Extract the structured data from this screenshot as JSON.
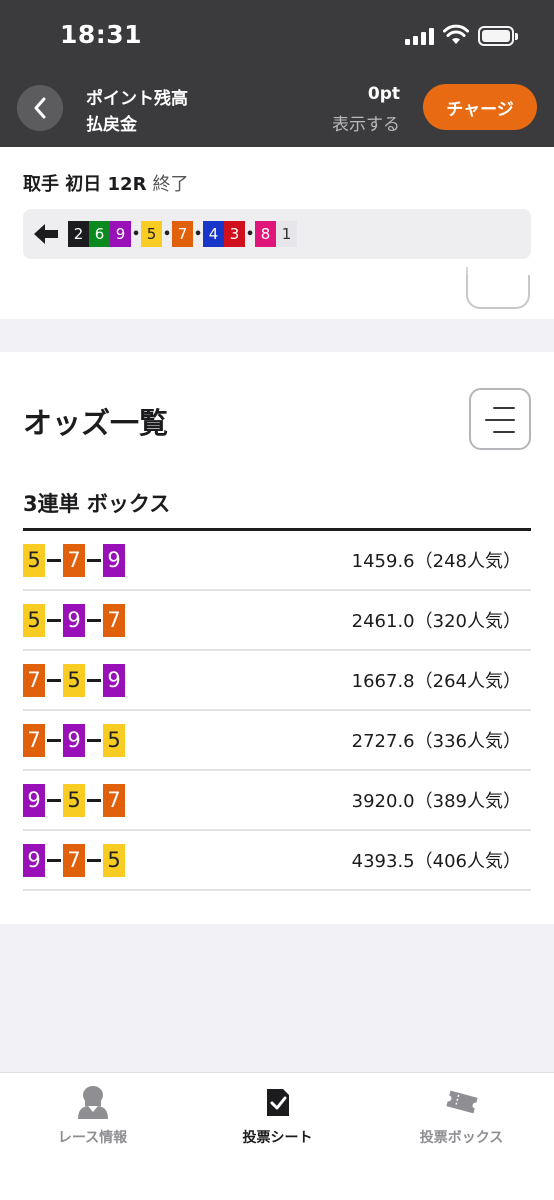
{
  "status_bar": {
    "time": "18:31"
  },
  "header": {
    "point_label": "ポイント残高",
    "payout_label": "払戻金",
    "point_value": "0pt",
    "show_label": "表示する",
    "charge_label": "チャージ"
  },
  "race": {
    "title": "取手 初日 12R",
    "status": "終了",
    "order": [
      {
        "n": "2",
        "sep": ""
      },
      {
        "n": "6",
        "sep": ""
      },
      {
        "n": "9",
        "sep": "•"
      },
      {
        "n": "5",
        "sep": "•"
      },
      {
        "n": "7",
        "sep": "•"
      },
      {
        "n": "4",
        "sep": ""
      },
      {
        "n": "3",
        "sep": "•"
      },
      {
        "n": "8",
        "sep": ""
      },
      {
        "n": "1",
        "sep": ""
      }
    ]
  },
  "odds": {
    "title": "オッズ一覧",
    "subtitle": "3連単 ボックス",
    "rows": [
      {
        "combo": [
          "5",
          "7",
          "9"
        ],
        "text": "1459.6（248人気）"
      },
      {
        "combo": [
          "5",
          "9",
          "7"
        ],
        "text": "2461.0（320人気）"
      },
      {
        "combo": [
          "7",
          "5",
          "9"
        ],
        "text": "1667.8（264人気）"
      },
      {
        "combo": [
          "7",
          "9",
          "5"
        ],
        "text": "2727.6（336人気）"
      },
      {
        "combo": [
          "9",
          "5",
          "7"
        ],
        "text": "3920.0（389人気）"
      },
      {
        "combo": [
          "9",
          "7",
          "5"
        ],
        "text": "4393.5（406人気）"
      }
    ]
  },
  "tabs": [
    {
      "label": "レース情報",
      "icon": "racer-icon"
    },
    {
      "label": "投票シート",
      "icon": "vote-sheet-icon"
    },
    {
      "label": "投票ボックス",
      "icon": "ticket-icon"
    }
  ],
  "active_tab": 1,
  "colors": {
    "header_bg": "#3b3b3d",
    "charge": "#e86a12",
    "waku": {
      "1": "#e6e6ea",
      "2": "#1c1c1e",
      "3": "#d0101c",
      "4": "#1836c8",
      "5": "#f8cc23",
      "6": "#0a8a1e",
      "7": "#e0600c",
      "8": "#e0157a",
      "9": "#9a10b8"
    }
  }
}
